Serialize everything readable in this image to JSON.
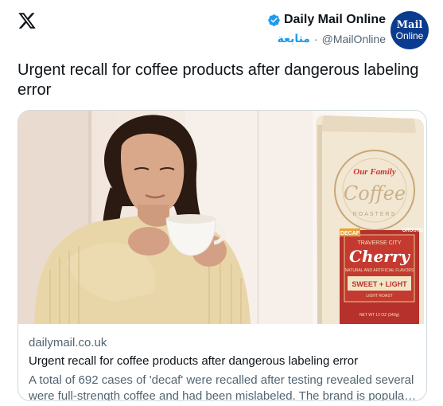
{
  "header": {
    "account_name": "Daily Mail Online",
    "follow_label": "متابعة",
    "separator": "·",
    "handle": "@MailOnline",
    "avatar_line1": "Mail",
    "avatar_line2": "Online"
  },
  "tweet": {
    "text": "Urgent recall for coffee products after dangerous labeling error"
  },
  "card": {
    "domain": "dailymail.co.uk",
    "title": "Urgent recall for coffee products after dangerous labeling error",
    "description": "A total of 692 cases of 'decaf' were recalled after testing revealed several were full-strength coffee and had been mislabeled. The brand is popular with...",
    "package": {
      "brand": "Our Family",
      "word": "Coffee",
      "ring": "ROASTERS",
      "badge": "DECAF",
      "line1": "TRAVERSE CITY",
      "line2": "Cherry",
      "line3": "NATURAL AND ARTIFICIAL FLAVORS",
      "line4": "SWEET + LIGHT",
      "line5": "LIGHT ROAST",
      "weight": "NET WT 12 OZ (340g)",
      "ground": "GROUND"
    }
  }
}
